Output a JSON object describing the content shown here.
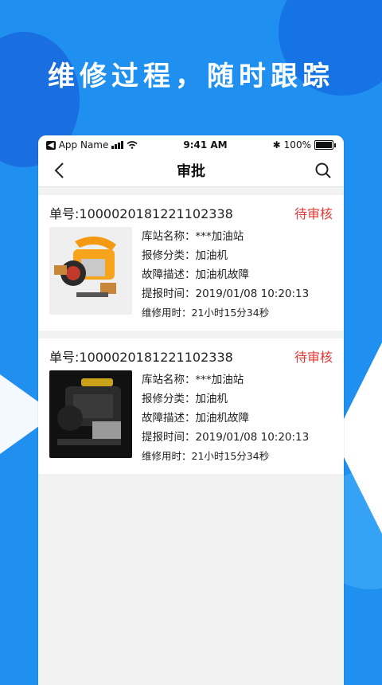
{
  "headline": "维修过程，随时跟踪",
  "status_bar": {
    "app_name": "App Name",
    "time": "9:41 AM",
    "battery": "100%"
  },
  "nav": {
    "title": "审批",
    "back_icon": "chevron-left-icon",
    "search_icon": "search-icon"
  },
  "orders": [
    {
      "order_no": "单号:1000020181221102338",
      "status": "待审核",
      "station": "库站名称：***加油站",
      "category": "报修分类：加油机",
      "fault": "故障描述：加油机故障",
      "report_time": "提报时间：2019/01/08  10:20:13",
      "duration": "维修用时：21小时15分34秒",
      "image": "orange-pump-image"
    },
    {
      "order_no": "单号:1000020181221102338",
      "status": "待审核",
      "station": "库站名称：***加油站",
      "category": "报修分类：加油机",
      "fault": "故障描述：加油机故障",
      "report_time": "提报时间：2019/01/08  10:20:13",
      "duration": "维修用时：21小时15分34秒",
      "image": "black-pump-image"
    }
  ],
  "colors": {
    "background": "#1f8ff0",
    "status_red": "#e53935"
  }
}
